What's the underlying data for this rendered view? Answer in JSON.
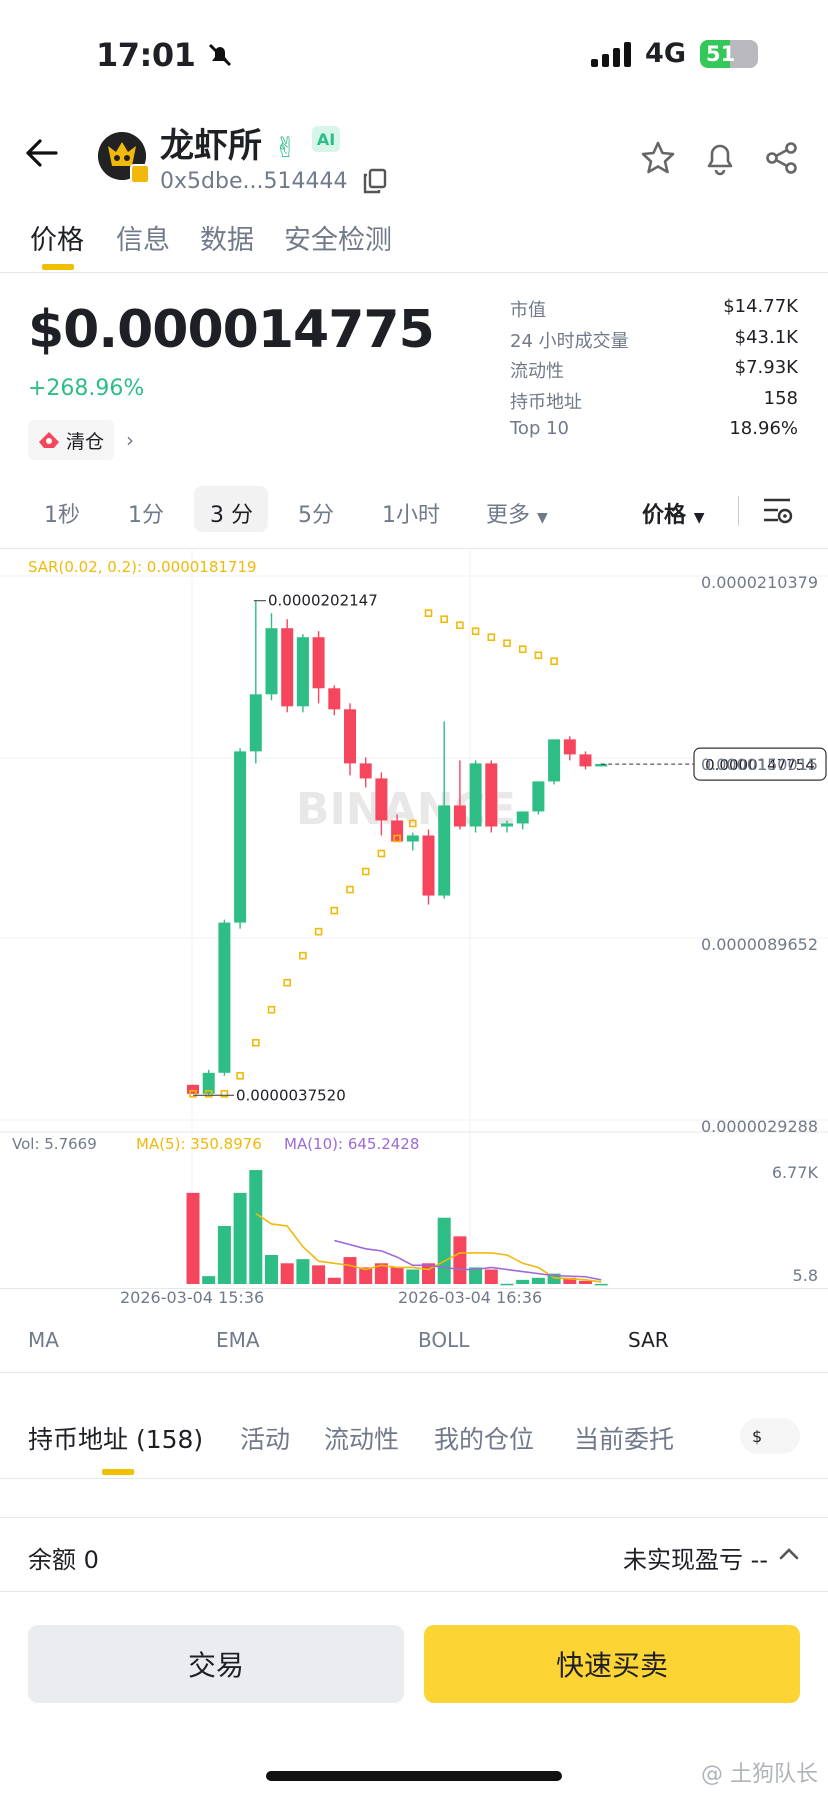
{
  "status_bar": {
    "time": "17:01",
    "network": "4G",
    "battery": "51"
  },
  "header": {
    "token_name": "龙虾所",
    "ai_badge": "AI",
    "address": "0x5dbe...514444"
  },
  "top_tabs": [
    "价格",
    "信息",
    "数据",
    "安全检测"
  ],
  "price": {
    "value": "$0.000014775",
    "change": "+268.96%",
    "chip_label": "清仓"
  },
  "stats": [
    {
      "label": "市值",
      "value": "$14.77K"
    },
    {
      "label": "24 小时成交量",
      "value": "$43.1K"
    },
    {
      "label": "流动性",
      "value": "$7.93K"
    },
    {
      "label": "持币地址",
      "value": "158"
    },
    {
      "label": "Top 10",
      "value": "18.96%"
    }
  ],
  "intervals": [
    "1秒",
    "1分",
    "3 分",
    "5分",
    "1小时",
    "更多"
  ],
  "active_interval": "3 分",
  "price_toggle": "价格",
  "chart_data": {
    "type": "candlestick",
    "indicator_label": "SAR(0.02, 0.2): 0.0000181719",
    "y_ticks": [
      "0.0000210379",
      "0.0000150015",
      "0.0000089652",
      "0.0000029288"
    ],
    "ylim": [
      2.9288e-06,
      2.10379e-05
    ],
    "high_label": "0.0000202147",
    "low_label": "0.0000037520",
    "current_price_label": "0.0000147754",
    "x_labels": [
      "2026-03-04 15:36",
      "2026-03-04 16:36"
    ],
    "watermark": "BINANCE",
    "colors": {
      "up": "#2ebd85",
      "down": "#f6465d",
      "sar": "#f0b90b",
      "ma5": "#f0b90b",
      "ma10": "#9c6ad8"
    },
    "candles": [
      {
        "o": 4.1,
        "h": 4.1,
        "l": 3.8,
        "c": 3.8
      },
      {
        "o": 3.8,
        "h": 4.6,
        "l": 3.75,
        "c": 4.5
      },
      {
        "o": 4.5,
        "h": 9.6,
        "l": 4.4,
        "c": 9.5
      },
      {
        "o": 9.5,
        "h": 15.3,
        "l": 9.3,
        "c": 15.2
      },
      {
        "o": 15.2,
        "h": 20.2,
        "l": 14.8,
        "c": 17.1
      },
      {
        "o": 17.1,
        "h": 19.8,
        "l": 16.9,
        "c": 19.3
      },
      {
        "o": 19.3,
        "h": 19.6,
        "l": 16.5,
        "c": 16.7
      },
      {
        "o": 16.7,
        "h": 19.1,
        "l": 16.5,
        "c": 19.0
      },
      {
        "o": 19.0,
        "h": 19.2,
        "l": 16.8,
        "c": 17.3
      },
      {
        "o": 17.3,
        "h": 17.4,
        "l": 16.4,
        "c": 16.6
      },
      {
        "o": 16.6,
        "h": 16.8,
        "l": 14.4,
        "c": 14.8
      },
      {
        "o": 14.8,
        "h": 15.0,
        "l": 14.0,
        "c": 14.3
      },
      {
        "o": 14.3,
        "h": 14.5,
        "l": 12.4,
        "c": 12.9
      },
      {
        "o": 12.9,
        "h": 13.1,
        "l": 12.3,
        "c": 12.2
      },
      {
        "o": 12.2,
        "h": 12.5,
        "l": 11.9,
        "c": 12.4
      },
      {
        "o": 12.4,
        "h": 12.6,
        "l": 10.1,
        "c": 10.4
      },
      {
        "o": 10.4,
        "h": 16.2,
        "l": 10.3,
        "c": 13.4
      },
      {
        "o": 13.4,
        "h": 14.9,
        "l": 12.6,
        "c": 12.7
      },
      {
        "o": 12.7,
        "h": 14.9,
        "l": 12.5,
        "c": 14.8
      },
      {
        "o": 14.8,
        "h": 14.9,
        "l": 12.5,
        "c": 12.7
      },
      {
        "o": 12.7,
        "h": 12.9,
        "l": 12.5,
        "c": 12.8
      },
      {
        "o": 12.8,
        "h": 13.1,
        "l": 12.6,
        "c": 13.2
      },
      {
        "o": 13.2,
        "h": 14.2,
        "l": 13.1,
        "c": 14.2
      },
      {
        "o": 14.2,
        "h": 15.6,
        "l": 14.1,
        "c": 15.6
      },
      {
        "o": 15.6,
        "h": 15.7,
        "l": 14.9,
        "c": 15.1
      },
      {
        "o": 15.1,
        "h": 15.2,
        "l": 14.6,
        "c": 14.7
      },
      {
        "o": 14.7,
        "h": 14.8,
        "l": 14.7,
        "c": 14.78
      }
    ],
    "sar_points": [
      3.8,
      3.8,
      3.8,
      4.4,
      5.5,
      6.6,
      7.5,
      8.4,
      9.2,
      9.9,
      10.6,
      11.2,
      11.8,
      12.3,
      12.8,
      19.8,
      19.6,
      19.4,
      19.2,
      19.0,
      18.8,
      18.6,
      18.4,
      18.2
    ],
    "volume": {
      "label": "Vol: 5.7669",
      "ma5_label": "MA(5): 350.8976",
      "ma10_label": "MA(10): 645.2428",
      "y_max_label": "6.77K",
      "y_min_label": "5.8",
      "bars": [
        4400,
        380,
        2800,
        4400,
        5500,
        1400,
        1000,
        1200,
        900,
        300,
        1300,
        800,
        1000,
        800,
        700,
        1000,
        3200,
        2300,
        800,
        700,
        10,
        200,
        300,
        500,
        300,
        150,
        6
      ],
      "ma5": [
        null,
        null,
        null,
        null,
        3400,
        2900,
        2800,
        1800,
        1100,
        1000,
        900,
        700,
        900,
        800,
        800,
        700,
        1100,
        1500,
        1500,
        1500,
        1400,
        1000,
        800,
        300,
        250,
        200,
        100
      ],
      "ma10": [
        null,
        null,
        null,
        null,
        null,
        null,
        null,
        null,
        null,
        2100,
        1900,
        1700,
        1600,
        1300,
        900,
        900,
        800,
        700,
        700,
        800,
        700,
        600,
        500,
        400,
        380,
        350,
        200
      ]
    }
  },
  "indicators": [
    "MA",
    "EMA",
    "BOLL",
    "SAR"
  ],
  "active_indicator": "SAR",
  "bottom_tabs": [
    "持币地址 (158)",
    "活动",
    "流动性",
    "我的仓位",
    "当前委托"
  ],
  "currency_chip": "$",
  "balance": "余额 0",
  "unrealized_pnl": "未实现盈亏 --",
  "buttons": {
    "trade": "交易",
    "quick_trade": "快速买卖"
  },
  "watermark_text": "@ 土狗队长"
}
